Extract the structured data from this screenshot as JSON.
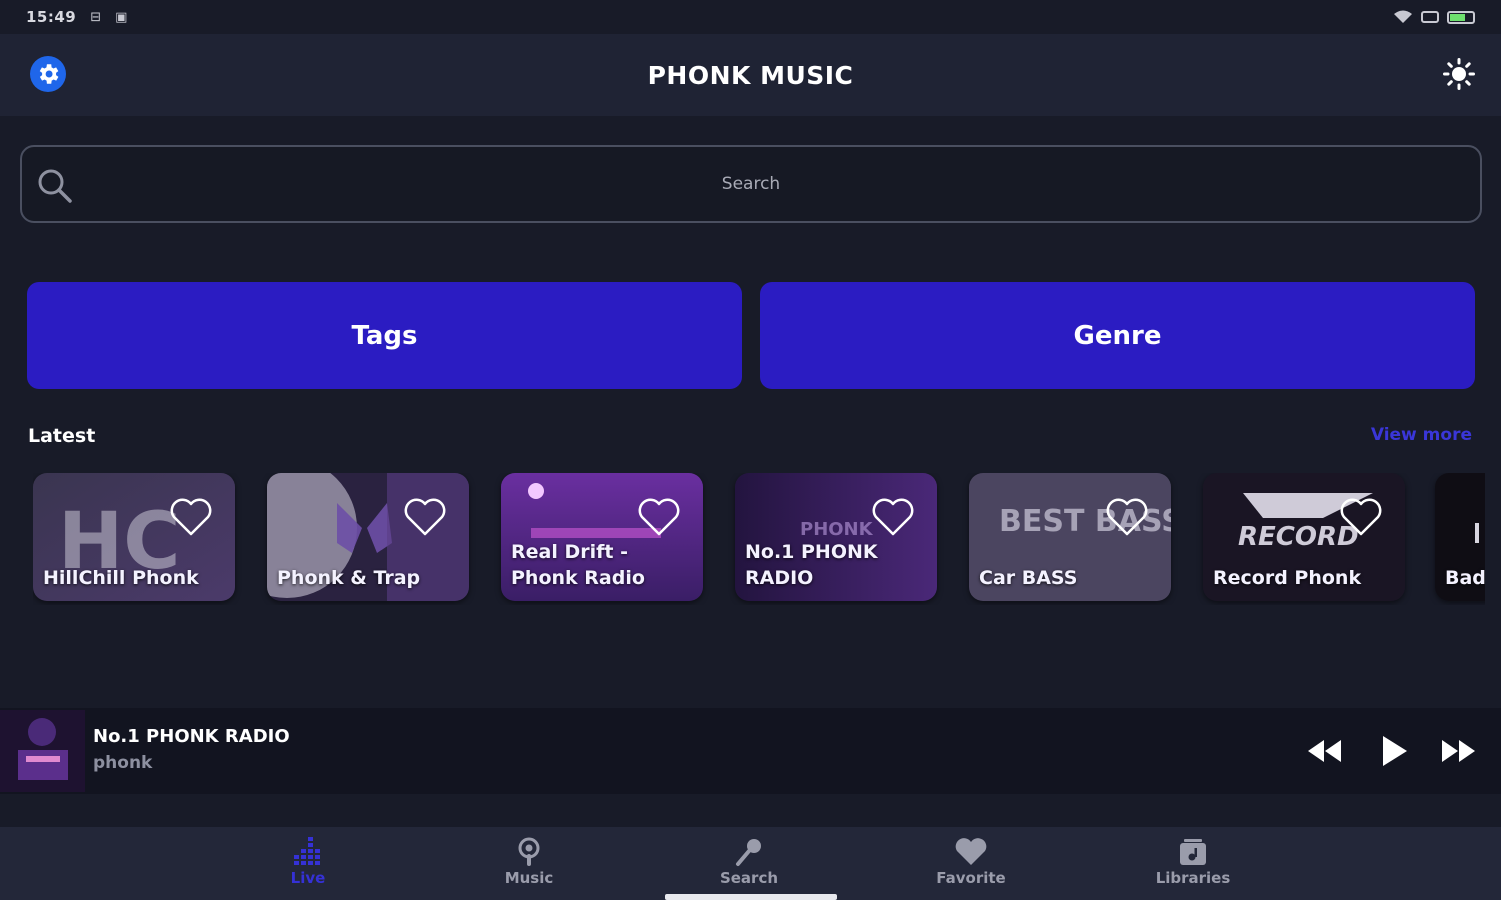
{
  "status_bar": {
    "time": "15:49",
    "icons": [
      "sim-icon",
      "notification-icon"
    ],
    "right_icons": [
      "wifi-icon",
      "screen-icon",
      "battery-icon"
    ]
  },
  "app_bar": {
    "title": "PHONK MUSIC",
    "left_icon": "gear-icon",
    "right_icon": "sun-icon"
  },
  "search": {
    "placeholder": "Search"
  },
  "buttons": {
    "tags": "Tags",
    "genre": "Genre"
  },
  "latest": {
    "heading": "Latest",
    "view_more": "View more",
    "stations": [
      {
        "name": "HillChill Phonk",
        "art_text": "HC"
      },
      {
        "name": "Phonk & Trap",
        "art_text": ""
      },
      {
        "name": "Real Drift -\nPhonk Radio",
        "art_text": ""
      },
      {
        "name": "No.1 PHONK\nRADIO",
        "art_text": "PHONK"
      },
      {
        "name": "Car BASS",
        "art_text": "BEST BASS"
      },
      {
        "name": "Record Phonk",
        "art_text": "RECORD"
      },
      {
        "name": "Bad",
        "art_text": ""
      }
    ]
  },
  "player": {
    "title": "No.1 PHONK RADIO",
    "subtitle": "phonk"
  },
  "bottom_nav": [
    {
      "label": "Live",
      "icon": "equalizer-icon",
      "active": true
    },
    {
      "label": "Music",
      "icon": "podcast-icon",
      "active": false
    },
    {
      "label": "Search",
      "icon": "microphone-icon",
      "active": false
    },
    {
      "label": "Favorite",
      "icon": "heart-icon",
      "active": false
    },
    {
      "label": "Libraries",
      "icon": "library-icon",
      "active": false
    }
  ],
  "colors": {
    "background": "#181b28",
    "accent": "#2b1cc2",
    "active_nav": "#3531d6",
    "gear": "#1f66ea",
    "view_more": "#3a36d8"
  }
}
